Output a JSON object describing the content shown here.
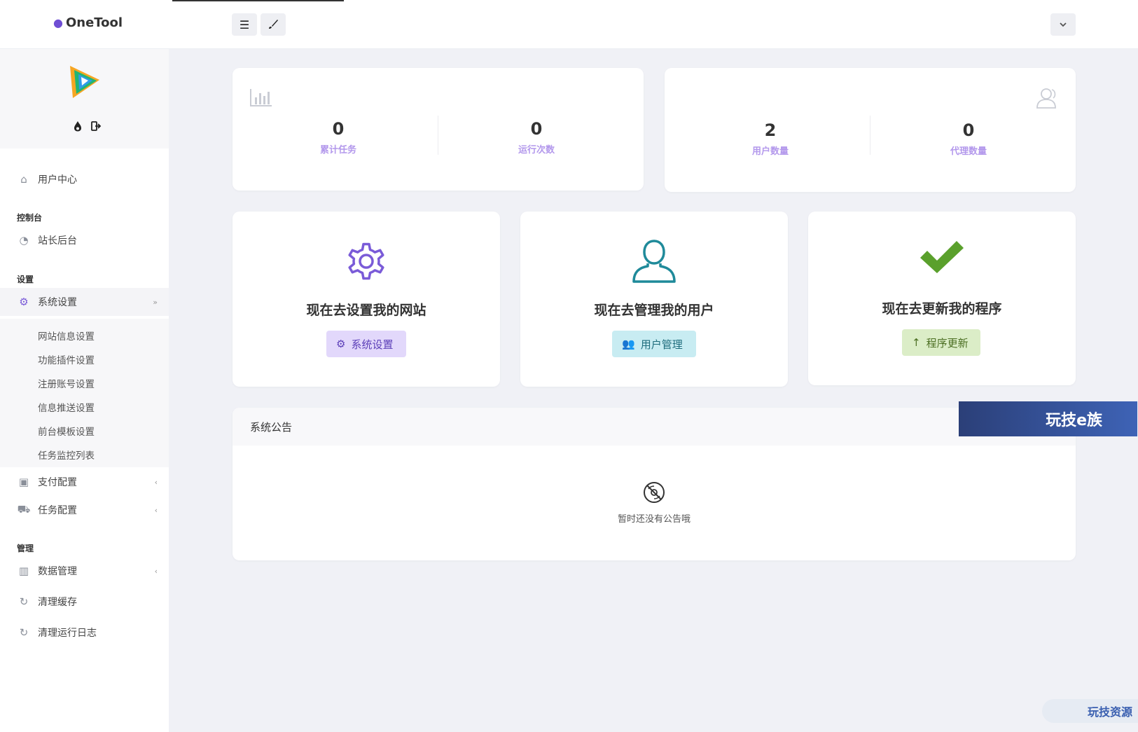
{
  "header": {
    "app_name": "OneTool",
    "menu_icon": "☰",
    "brush_icon": "🖌",
    "user_dropdown_icon": "⌄"
  },
  "sidebar": {
    "sections": {
      "console": "控制台",
      "settings": "设置",
      "manage": "管理"
    },
    "items": {
      "user_center": "用户中心",
      "admin_backend": "站长后台",
      "system_settings": "系统设置",
      "payment_config": "支付配置",
      "task_config": "任务配置",
      "data_manage": "数据管理",
      "clear_cache": "清理缓存",
      "clear_logs": "清理运行日志"
    },
    "submenu": [
      "网站信息设置",
      "功能插件设置",
      "注册账号设置",
      "信息推送设置",
      "前台模板设置",
      "任务监控列表"
    ]
  },
  "stats": {
    "total_tasks": {
      "value": "0",
      "label": "累计任务"
    },
    "run_count": {
      "value": "0",
      "label": "运行次数"
    },
    "user_count": {
      "value": "2",
      "label": "用户数量"
    },
    "agent_count": {
      "value": "0",
      "label": "代理数量"
    }
  },
  "actions": {
    "site": {
      "title": "现在去设置我的网站",
      "button": "系统设置"
    },
    "users": {
      "title": "现在去管理我的用户",
      "button": "用户管理"
    },
    "update": {
      "title": "现在去更新我的程序",
      "button": "程序更新"
    }
  },
  "notice": {
    "title": "系统公告",
    "empty_text": "暂时还没有公告哦"
  },
  "watermarks": {
    "banner": "玩技e族",
    "corner": "玩技资源"
  },
  "colors": {
    "accent": "#7a5bd8",
    "teal": "#1f8a9a",
    "green": "#5aa02c"
  }
}
